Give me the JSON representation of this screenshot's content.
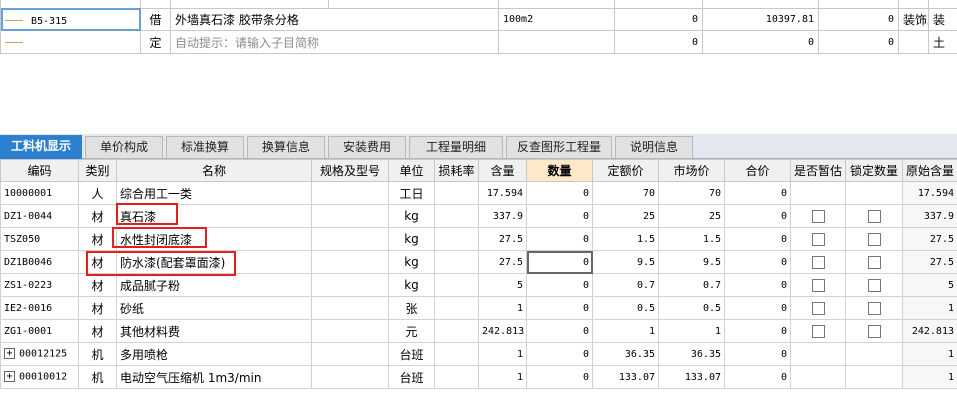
{
  "top_rows": [
    {
      "code": "B5-315",
      "type": "借",
      "name": "外墙真石漆 胶带条分格",
      "unit": "100m2",
      "v1": "0",
      "v2": "10397.81",
      "v3": "0",
      "category": "装饰工程",
      "extra": "装"
    },
    {
      "code": "",
      "type": "定",
      "name": "自动提示：请输入子目简称",
      "unit": "",
      "v1": "0",
      "v2": "0",
      "v3": "0",
      "category": "",
      "extra": "土"
    }
  ],
  "tabs": [
    "工料机显示",
    "单价构成",
    "标准换算",
    "换算信息",
    "安装费用",
    "工程量明细",
    "反查图形工程量",
    "说明信息"
  ],
  "columns": [
    "编码",
    "类别",
    "名称",
    "规格及型号",
    "单位",
    "损耗率",
    "含量",
    "数量",
    "定额价",
    "市场价",
    "合价",
    "是否暂估",
    "锁定数量",
    "原始含量"
  ],
  "rows": [
    {
      "code": "10000001",
      "type": "人",
      "name": "综合用工一类",
      "unit": "工日",
      "content": "17.594",
      "qty": "0",
      "quota": "70",
      "market": "70",
      "total": "0",
      "orig": "17.594",
      "checks": false,
      "expand": false
    },
    {
      "code": "DZ1-0044",
      "type": "材",
      "name": "真石漆",
      "unit": "kg",
      "content": "337.9",
      "qty": "0",
      "quota": "25",
      "market": "25",
      "total": "0",
      "orig": "337.9",
      "checks": true,
      "expand": false
    },
    {
      "code": "TSZ050",
      "type": "材",
      "name": "水性封闭底漆",
      "unit": "kg",
      "content": "27.5",
      "qty": "0",
      "quota": "1.5",
      "market": "1.5",
      "total": "0",
      "orig": "27.5",
      "checks": true,
      "expand": false
    },
    {
      "code": "DZ1B0046",
      "type": "材",
      "name": "防水漆(配套罩面漆)",
      "unit": "kg",
      "content": "27.5",
      "qty": "0",
      "quota": "9.5",
      "market": "9.5",
      "total": "0",
      "orig": "27.5",
      "checks": true,
      "expand": false
    },
    {
      "code": "ZS1-0223",
      "type": "材",
      "name": "成品腻子粉",
      "unit": "kg",
      "content": "5",
      "qty": "0",
      "quota": "0.7",
      "market": "0.7",
      "total": "0",
      "orig": "5",
      "checks": true,
      "expand": false
    },
    {
      "code": "IE2-0016",
      "type": "材",
      "name": "砂纸",
      "unit": "张",
      "content": "1",
      "qty": "0",
      "quota": "0.5",
      "market": "0.5",
      "total": "0",
      "orig": "1",
      "checks": true,
      "expand": false
    },
    {
      "code": "ZG1-0001",
      "type": "材",
      "name": "其他材料费",
      "unit": "元",
      "content": "242.813",
      "qty": "0",
      "quota": "1",
      "market": "1",
      "total": "0",
      "orig": "242.813",
      "checks": true,
      "expand": false
    },
    {
      "code": "00012125",
      "type": "机",
      "name": "多用喷枪",
      "unit": "台班",
      "content": "1",
      "qty": "0",
      "quota": "36.35",
      "market": "36.35",
      "total": "0",
      "orig": "1",
      "checks": false,
      "expand": true
    },
    {
      "code": "00010012",
      "type": "机",
      "name": "电动空气压缩机 1m3/min",
      "unit": "台班",
      "content": "1",
      "qty": "0",
      "quota": "133.07",
      "market": "133.07",
      "total": "0",
      "orig": "1",
      "checks": false,
      "expand": true
    }
  ],
  "icons": {
    "expand": "plus-box-icon",
    "checkbox": "checkbox-icon"
  }
}
